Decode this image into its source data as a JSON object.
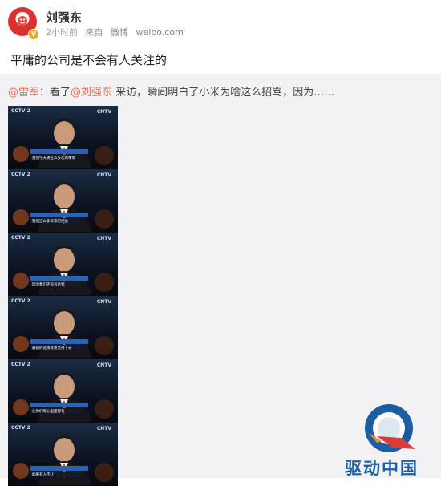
{
  "post": {
    "author_name": "刘强东",
    "time": "2小时前",
    "source_prefix": "来自",
    "source_name": "微博",
    "source_domain": "weibo.com",
    "text": "平庸的公司是不会有人关注的"
  },
  "repost": {
    "mention_author": "@雷军",
    "colon": "：",
    "text_before": "看了",
    "mention_user": "@刘强东",
    "text_after": " 采访，瞬间明白了小米为啥这么招骂，因为……"
  },
  "images": [
    {
      "cctv_left": "CCTV 2",
      "cctv_right": "CNTV",
      "caption": "我们今天讲这么多次的事情"
    },
    {
      "cctv_left": "CCTV 2",
      "cctv_right": "CNTV",
      "caption": "我们这么多年来的经验"
    },
    {
      "cctv_left": "CCTV 2",
      "cctv_right": "CNTV",
      "caption": "因为我们还没有达到"
    },
    {
      "cctv_left": "CCTV 2",
      "cctv_right": "CNTV",
      "caption": "最初的选择就要坚持下去"
    },
    {
      "cctv_left": "CCTV 2",
      "cctv_right": "CNTV",
      "caption": "让你们每心里面都有"
    },
    {
      "cctv_left": "CCTV 2",
      "cctv_right": "CNTV",
      "caption": "如果有人不让"
    }
  ],
  "watermark": {
    "text": "驱动中国",
    "colors": {
      "blue": "#1d5ea3",
      "red": "#e0393a"
    }
  },
  "colors": {
    "accent": "#eb7350",
    "repost_bg": "#f2f2f5"
  }
}
